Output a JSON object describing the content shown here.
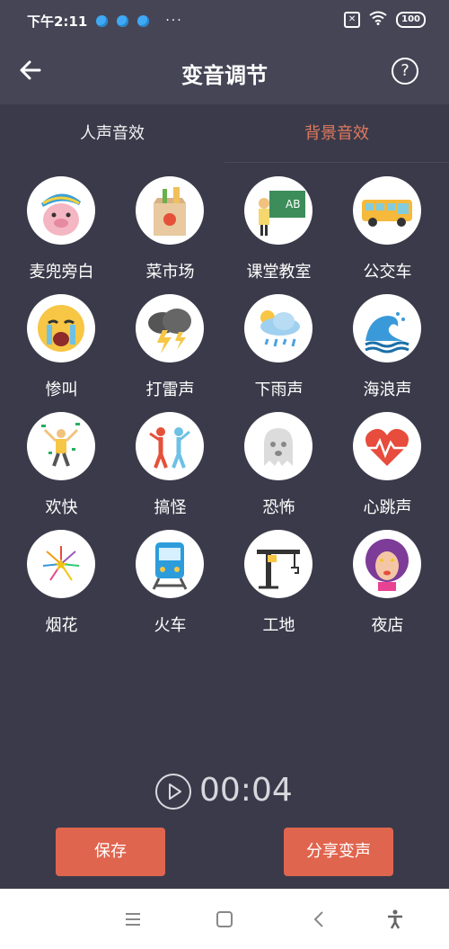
{
  "status": {
    "time": "下午2:11",
    "more": "···",
    "sim_icon": "sim-x",
    "battery": "100"
  },
  "header": {
    "title": "变音调节",
    "help_label": "?"
  },
  "tabs": [
    {
      "label": "人声音效",
      "active": false
    },
    {
      "label": "背景音效",
      "active": true
    }
  ],
  "effects": [
    {
      "label": "麦兜旁白",
      "icon": "pig-icon"
    },
    {
      "label": "菜市场",
      "icon": "grocery-bag-icon"
    },
    {
      "label": "课堂教室",
      "icon": "classroom-icon"
    },
    {
      "label": "公交车",
      "icon": "bus-icon"
    },
    {
      "label": "惨叫",
      "icon": "crying-face-icon"
    },
    {
      "label": "打雷声",
      "icon": "thunderstorm-icon"
    },
    {
      "label": "下雨声",
      "icon": "rain-cloud-icon"
    },
    {
      "label": "海浪声",
      "icon": "wave-icon"
    },
    {
      "label": "欢快",
      "icon": "dancing-person-icon"
    },
    {
      "label": "搞怪",
      "icon": "funny-dancers-icon"
    },
    {
      "label": "恐怖",
      "icon": "ghost-icon"
    },
    {
      "label": "心跳声",
      "icon": "heartbeat-icon"
    },
    {
      "label": "烟花",
      "icon": "fireworks-icon"
    },
    {
      "label": "火车",
      "icon": "train-icon"
    },
    {
      "label": "工地",
      "icon": "crane-icon"
    },
    {
      "label": "夜店",
      "icon": "party-woman-icon"
    }
  ],
  "player": {
    "time": "00:04"
  },
  "actions": {
    "save_label": "保存",
    "share_label": "分享变声"
  },
  "colors": {
    "background": "#3b3a4a",
    "header": "#464556",
    "accent": "#e0654f",
    "tab_active": "#e07a5f"
  }
}
